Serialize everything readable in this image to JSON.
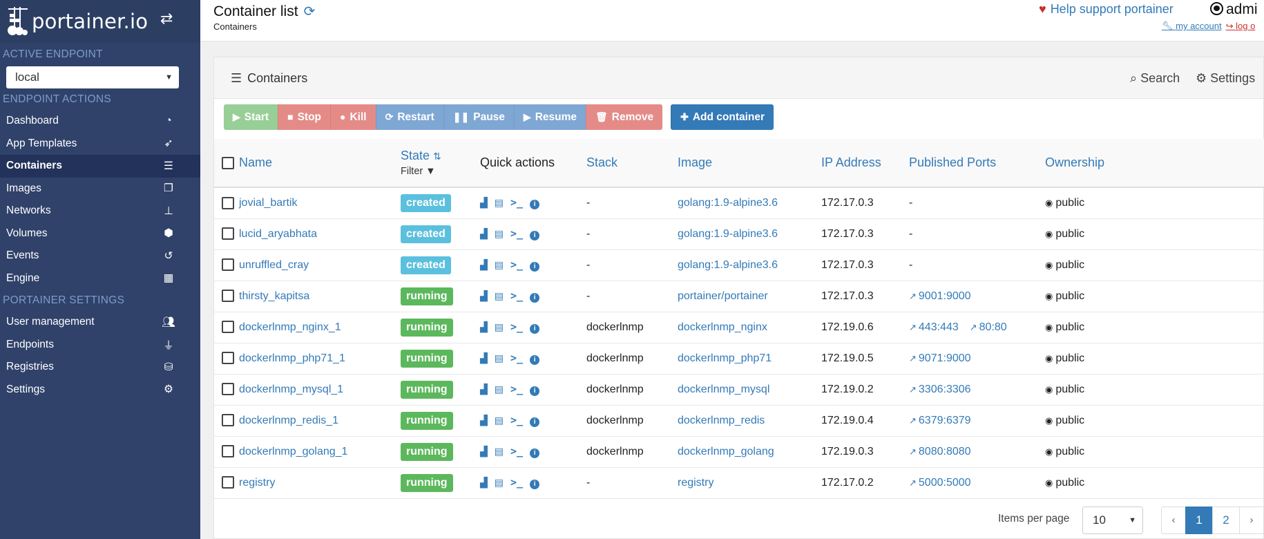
{
  "brand": {
    "name": "portainer.io"
  },
  "sidebar": {
    "active_endpoint_heading": "ACTIVE ENDPOINT",
    "endpoint_value": "local",
    "endpoint_actions_heading": "ENDPOINT ACTIONS",
    "endpoint_items": [
      {
        "label": "Dashboard",
        "icon": "tachometer-icon"
      },
      {
        "label": "App Templates",
        "icon": "rocket-icon"
      },
      {
        "label": "Containers",
        "icon": "server-icon",
        "active": true
      },
      {
        "label": "Images",
        "icon": "clone-icon"
      },
      {
        "label": "Networks",
        "icon": "sitemap-icon"
      },
      {
        "label": "Volumes",
        "icon": "cubes-icon"
      },
      {
        "label": "Events",
        "icon": "history-icon"
      },
      {
        "label": "Engine",
        "icon": "th-icon"
      }
    ],
    "settings_heading": "PORTAINER SETTINGS",
    "settings_items": [
      {
        "label": "User management",
        "icon": "users-icon"
      },
      {
        "label": "Endpoints",
        "icon": "plug-icon"
      },
      {
        "label": "Registries",
        "icon": "database-icon"
      },
      {
        "label": "Settings",
        "icon": "cogs-icon"
      }
    ]
  },
  "header": {
    "title": "Container list",
    "breadcrumb": "Containers",
    "support": "Help support portainer",
    "user": "admi",
    "my_account": "my account",
    "log_out": "log o"
  },
  "panel": {
    "title": "Containers",
    "search": "Search",
    "settings": "Settings"
  },
  "actions": {
    "start": "Start",
    "stop": "Stop",
    "kill": "Kill",
    "restart": "Restart",
    "pause": "Pause",
    "resume": "Resume",
    "remove": "Remove",
    "add": "Add container"
  },
  "table": {
    "headers": {
      "name": "Name",
      "state": "State",
      "filter": "Filter",
      "quick_actions": "Quick actions",
      "stack": "Stack",
      "image": "Image",
      "ip": "IP Address",
      "ports": "Published Ports",
      "ownership": "Ownership"
    },
    "rows": [
      {
        "name": "jovial_bartik",
        "state": "created",
        "stack": "-",
        "image": "golang:1.9-alpine3.6",
        "ip": "172.17.0.3",
        "ports": [],
        "ports_empty": "-",
        "ownership": "public"
      },
      {
        "name": "lucid_aryabhata",
        "state": "created",
        "stack": "-",
        "image": "golang:1.9-alpine3.6",
        "ip": "172.17.0.3",
        "ports": [],
        "ports_empty": "-",
        "ownership": "public"
      },
      {
        "name": "unruffled_cray",
        "state": "created",
        "stack": "-",
        "image": "golang:1.9-alpine3.6",
        "ip": "172.17.0.3",
        "ports": [],
        "ports_empty": "-",
        "ownership": "public"
      },
      {
        "name": "thirsty_kapitsa",
        "state": "running",
        "stack": "-",
        "image": "portainer/portainer",
        "ip": "172.17.0.3",
        "ports": [
          "9001:9000"
        ],
        "ownership": "public"
      },
      {
        "name": "dockerlnmp_nginx_1",
        "state": "running",
        "stack": "dockerlnmp",
        "image": "dockerlnmp_nginx",
        "ip": "172.19.0.6",
        "ports": [
          "443:443",
          "80:80"
        ],
        "ownership": "public"
      },
      {
        "name": "dockerlnmp_php71_1",
        "state": "running",
        "stack": "dockerlnmp",
        "image": "dockerlnmp_php71",
        "ip": "172.19.0.5",
        "ports": [
          "9071:9000"
        ],
        "ownership": "public"
      },
      {
        "name": "dockerlnmp_mysql_1",
        "state": "running",
        "stack": "dockerlnmp",
        "image": "dockerlnmp_mysql",
        "ip": "172.19.0.2",
        "ports": [
          "3306:3306"
        ],
        "ownership": "public"
      },
      {
        "name": "dockerlnmp_redis_1",
        "state": "running",
        "stack": "dockerlnmp",
        "image": "dockerlnmp_redis",
        "ip": "172.19.0.4",
        "ports": [
          "6379:6379"
        ],
        "ownership": "public"
      },
      {
        "name": "dockerlnmp_golang_1",
        "state": "running",
        "stack": "dockerlnmp",
        "image": "dockerlnmp_golang",
        "ip": "172.19.0.3",
        "ports": [
          "8080:8080"
        ],
        "ownership": "public"
      },
      {
        "name": "registry",
        "state": "running",
        "stack": "-",
        "image": "registry",
        "ip": "172.17.0.2",
        "ports": [
          "5000:5000"
        ],
        "ownership": "public"
      }
    ]
  },
  "pagination": {
    "items_per_page_label": "Items per page",
    "items_per_page": "10",
    "prev": "‹",
    "pages": [
      "1",
      "2"
    ],
    "next": "›"
  }
}
